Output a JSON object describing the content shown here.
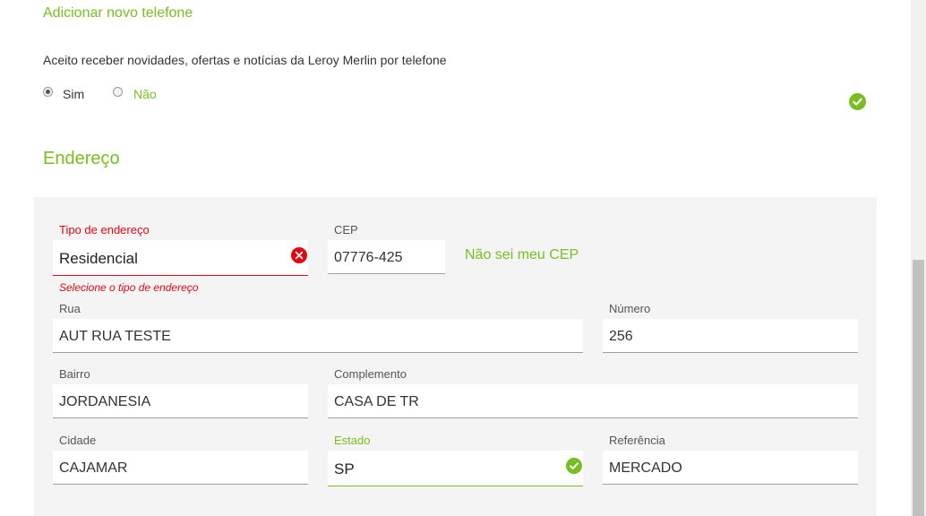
{
  "phone": {
    "add_link": "Adicionar novo telefone",
    "consent_text": "Aceito receber novidades, ofertas e notícias da Leroy Merlin por telefone",
    "option_yes": "Sim",
    "option_no": "Não"
  },
  "address": {
    "title": "Endereço",
    "tipo": {
      "label": "Tipo de endereço",
      "value": "Residencial",
      "error": "Selecione o tipo de endereço"
    },
    "cep": {
      "label": "CEP",
      "value": "07776-425"
    },
    "cep_help_link": "Não sei meu CEP",
    "rua": {
      "label": "Rua",
      "value": "AUT RUA TESTE"
    },
    "numero": {
      "label": "Número",
      "value": "256"
    },
    "bairro": {
      "label": "Bairro",
      "value": "JORDANESIA"
    },
    "complemento": {
      "label": "Complemento",
      "value": "CASA DE TR"
    },
    "cidade": {
      "label": "Cidade",
      "value": "CAJAMAR"
    },
    "estado": {
      "label": "Estado",
      "value": "SP"
    },
    "referencia": {
      "label": "Referência",
      "value": "MERCADO"
    }
  },
  "colors": {
    "brand_green": "#78be20",
    "error_red": "#e30613",
    "panel_bg": "#f4f4f4"
  },
  "icons": {
    "valid": "check-circle-icon",
    "clear_error": "x-circle-icon"
  }
}
